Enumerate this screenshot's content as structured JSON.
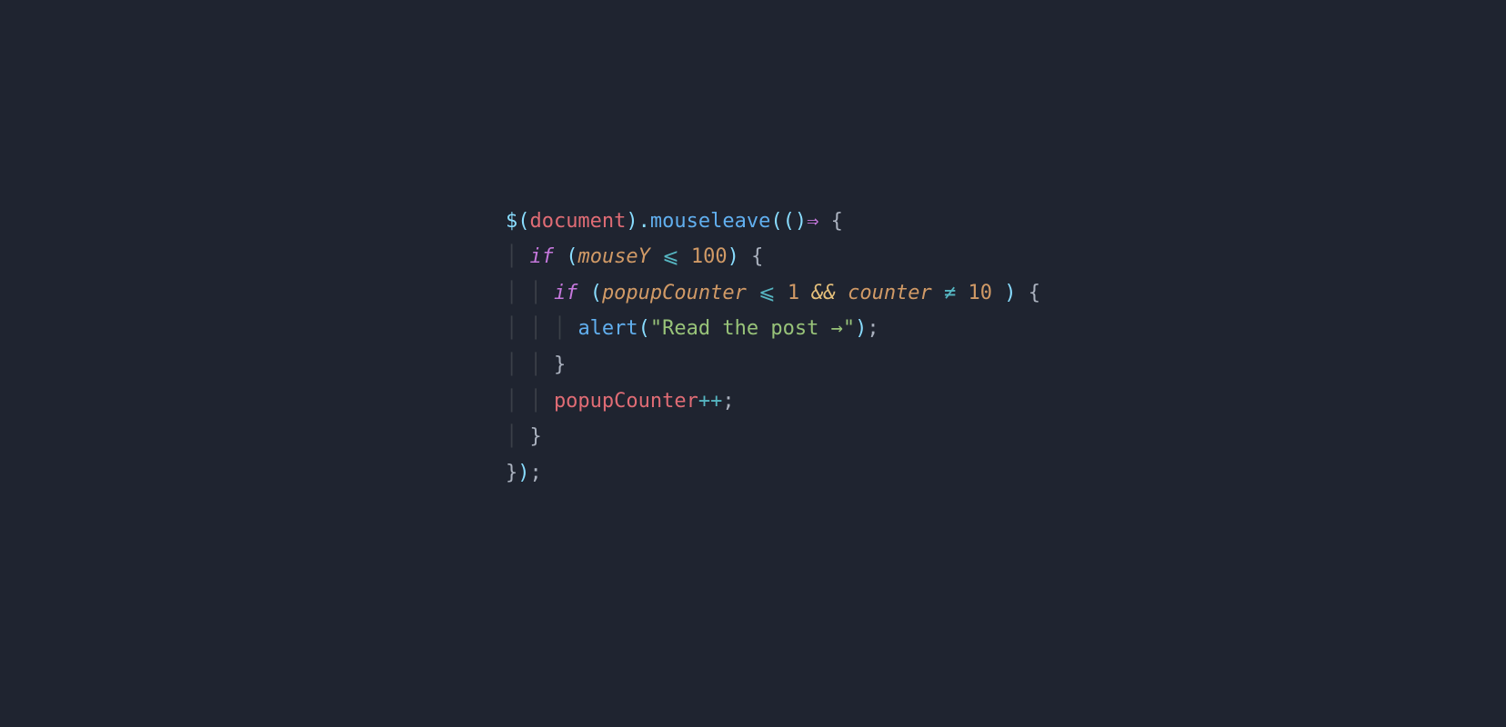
{
  "code": {
    "line1": {
      "dollar": "$",
      "lparen1": "(",
      "document": "document",
      "rparen1": ")",
      "dot": ".",
      "mouseleave": "mouseleave",
      "lparen2": "(",
      "lparen3": "(",
      "rparen3": ")",
      "arrow": "⇒",
      "space": " ",
      "lcurly": "{"
    },
    "line2": {
      "indent": "  ",
      "if": "if",
      "space1": " ",
      "lparen": "(",
      "mouseY": "mouseY",
      "space2": " ",
      "lte": "⩽",
      "space3": " ",
      "hundred": "100",
      "rparen": ")",
      "space4": " ",
      "lcurly": "{"
    },
    "line3": {
      "indent": "    ",
      "if": "if",
      "space1": " ",
      "lparen": "(",
      "popupCounter": "popupCounter",
      "space2": " ",
      "lte": "⩽",
      "space3": " ",
      "one": "1",
      "space4": " ",
      "and": "&&",
      "space5": " ",
      "counter": "counter",
      "space6": " ",
      "neq": "≠",
      "space7": " ",
      "ten": "10",
      "space8": " ",
      "rparen": ")",
      "space9": " ",
      "lcurly": "{"
    },
    "line4": {
      "indent": "      ",
      "alert": "alert",
      "lparen": "(",
      "string": "\"Read the post →\"",
      "rparen": ")",
      "semi": ";"
    },
    "line5": {
      "indent": "    ",
      "rcurly": "}"
    },
    "line6": {
      "indent": "    ",
      "popupCounter": "popupCounter",
      "inc": "++",
      "semi": ";"
    },
    "line7": {
      "indent": "  ",
      "rcurly": "}"
    },
    "line8": {
      "rcurly": "}",
      "rparen": ")",
      "semi": ";"
    }
  }
}
